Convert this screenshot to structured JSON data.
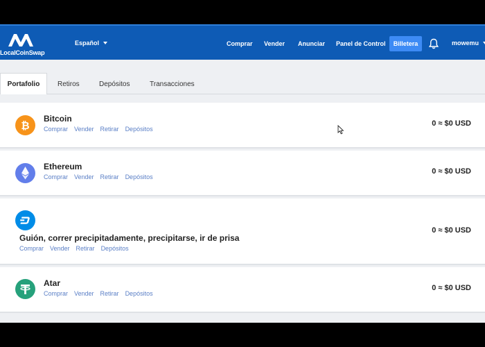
{
  "brand": {
    "name": "LocalCoinSwap"
  },
  "language": {
    "selected": "Español"
  },
  "nav": {
    "buy": "Comprar",
    "sell": "Vender",
    "advertise": "Anunciar",
    "dashboard": "Panel de Control",
    "wallet": "Billetera"
  },
  "user": {
    "name": "mowemu"
  },
  "tabs": {
    "portfolio": "Portafolio",
    "withdrawals": "Retiros",
    "deposits": "Depósitos",
    "transactions": "Transacciones"
  },
  "coins": [
    {
      "name": "Bitcoin",
      "balance": "0 ≈ $0 USD",
      "color": "#f7931a",
      "icon": "bitcoin-icon",
      "actions": {
        "buy": "Comprar",
        "sell": "Vender",
        "withdraw": "Retirar",
        "deposits": "Depósitos"
      }
    },
    {
      "name": "Ethereum",
      "balance": "0 ≈ $0 USD",
      "color": "#627eea",
      "icon": "ethereum-icon",
      "actions": {
        "buy": "Comprar",
        "sell": "Vender",
        "withdraw": "Retirar",
        "deposits": "Depósitos"
      }
    },
    {
      "name": "Guión, correr precipitadamente, precipitarse, ir de prisa",
      "balance": "0 ≈ $0 USD",
      "color": "#008ce7",
      "icon": "dash-icon",
      "actions": {
        "buy": "Comprar",
        "sell": "Vender",
        "withdraw": "Retirar",
        "deposits": "Depósitos"
      }
    },
    {
      "name": "Atar",
      "balance": "0 ≈ $0 USD",
      "color": "#26a17b",
      "icon": "tether-icon",
      "actions": {
        "buy": "Comprar",
        "sell": "Vender",
        "withdraw": "Retirar",
        "deposits": "Depósitos"
      }
    }
  ]
}
